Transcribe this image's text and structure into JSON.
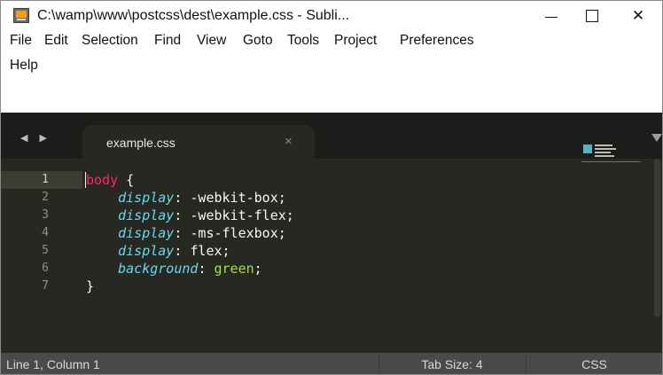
{
  "window": {
    "title": "C:\\wamp\\www\\postcss\\dest\\example.css - Subli...",
    "icons": {
      "app": "sublime-app-icon",
      "minimize": "minimize-icon",
      "maximize": "maximize-icon",
      "close": "close-icon"
    },
    "close_glyph": "✕"
  },
  "menu": {
    "row1": [
      "File",
      "Edit",
      "Selection",
      "Find",
      "View",
      "Goto",
      "Tools",
      "Project",
      "Preferences"
    ],
    "row2": [
      "Help"
    ]
  },
  "tabs": {
    "nav_arrows": "◀ ▶",
    "active": {
      "label": "example.css",
      "close_glyph": "×"
    }
  },
  "editor": {
    "line_numbers": [
      "1",
      "2",
      "3",
      "4",
      "5",
      "6",
      "7"
    ],
    "lines": [
      {
        "selector": "body",
        "brace": " {"
      },
      {
        "prop": "display",
        "value": " -webkit-box;"
      },
      {
        "prop": "display",
        "value": " -webkit-flex;"
      },
      {
        "prop": "display",
        "value": " -ms-flexbox;"
      },
      {
        "prop": "display",
        "value": " flex;"
      },
      {
        "prop": "background",
        "value_green": " green",
        "semi": ";"
      },
      {
        "brace": "}"
      }
    ],
    "theme_colors": {
      "background": "#272822",
      "selector": "#f92672",
      "property": "#66d9ef",
      "keyword_value": "#a6e22e",
      "text": "#f8f8f2"
    }
  },
  "status": {
    "position": "Line 1, Column 1",
    "tab_size": "Tab Size: 4",
    "syntax": "CSS"
  }
}
